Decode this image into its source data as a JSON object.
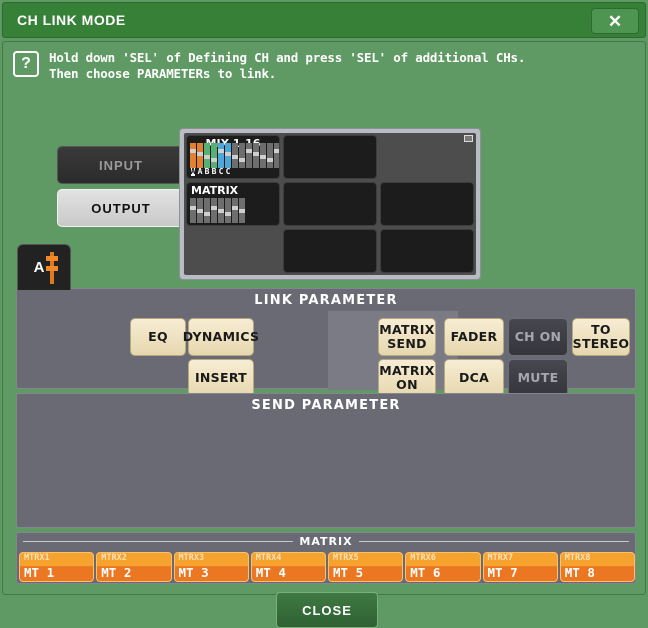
{
  "window": {
    "title": "CH LINK MODE",
    "close_icon": "close-x-icon",
    "close_button_label": "CLOSE"
  },
  "help": {
    "icon": "question-mark-icon",
    "line1": "Hold down 'SEL' of Defining CH and press 'SEL' of additional CHs.",
    "line2": "Then choose PARAMETERs to link."
  },
  "type_selector": {
    "input_label": "INPUT",
    "input_selected": false,
    "output_label": "OUTPUT",
    "output_selected": true
  },
  "bank_grid": {
    "cells": [
      {
        "label": "MIX 1-16",
        "label_align": "center",
        "has_strips": true,
        "filled": true
      },
      {
        "label": "",
        "label_align": "center",
        "has_strips": false,
        "filled": true
      },
      {
        "label": "",
        "label_align": "center",
        "has_strips": false,
        "filled": false
      },
      {
        "label": "MATRIX",
        "label_align": "left",
        "has_strips": true,
        "filled": true
      },
      {
        "label": "",
        "label_align": "center",
        "has_strips": false,
        "filled": true
      },
      {
        "label": "",
        "label_align": "center",
        "has_strips": false,
        "filled": true
      },
      {
        "label": "",
        "label_align": "center",
        "has_strips": false,
        "filled": false
      },
      {
        "label": "",
        "label_align": "center",
        "has_strips": false,
        "filled": true
      },
      {
        "label": "",
        "label_align": "center",
        "has_strips": false,
        "filled": true
      }
    ],
    "mix_link_letters": [
      "A",
      "A",
      "B",
      "B",
      "C",
      "C"
    ],
    "mix_link_colors": [
      "#e08030",
      "#e08030",
      "#57b074",
      "#57b074",
      "#4fa6d8",
      "#4fa6d8"
    ],
    "resize_grip_icon": "resize-grip-icon"
  },
  "link_tab": {
    "label": "A",
    "fader_icon": "fader-icon",
    "fader_color": "#e07820"
  },
  "link_parameter": {
    "title": "LINK PARAMETER",
    "dropdown_icon": "chevron-down-icon",
    "buttons": [
      {
        "name": "eq",
        "line1": "EQ",
        "line2": "",
        "active": true
      },
      {
        "name": "dynamics",
        "line1": "DYNAMICS",
        "line2": "",
        "active": true
      },
      {
        "name": "insert",
        "line1": "INSERT",
        "line2": "",
        "active": true
      },
      {
        "name": "matrix-send",
        "line1": "MATRIX",
        "line2": "SEND",
        "active": true
      },
      {
        "name": "matrix-on",
        "line1": "MATRIX",
        "line2": "ON",
        "active": true
      },
      {
        "name": "fader",
        "line1": "FADER",
        "line2": "",
        "active": true
      },
      {
        "name": "dca",
        "line1": "DCA",
        "line2": "",
        "active": true
      },
      {
        "name": "ch-on",
        "line1": "CH ON",
        "line2": "",
        "active": false
      },
      {
        "name": "mute",
        "line1": "MUTE",
        "line2": "",
        "active": false
      },
      {
        "name": "to-stereo",
        "line1": "TO",
        "line2": "STEREO",
        "active": true
      }
    ]
  },
  "send_parameter": {
    "title": "SEND PARAMETER"
  },
  "matrix_group": {
    "legend": "MATRIX",
    "buttons": [
      {
        "id": "MTRX1",
        "name": "MT 1"
      },
      {
        "id": "MTRX2",
        "name": "MT 2"
      },
      {
        "id": "MTRX3",
        "name": "MT 3"
      },
      {
        "id": "MTRX4",
        "name": "MT 4"
      },
      {
        "id": "MTRX5",
        "name": "MT 5"
      },
      {
        "id": "MTRX6",
        "name": "MT 6"
      },
      {
        "id": "MTRX7",
        "name": "MT 7"
      },
      {
        "id": "MTRX8",
        "name": "MT 8"
      }
    ]
  },
  "colors": {
    "window_green": "#5f9964",
    "title_green": "#378038",
    "panel_gray": "#6a6a74",
    "button_active": "#eddfb6",
    "button_inactive": "#3d3d45",
    "matrix_orange": "#ec7722"
  }
}
